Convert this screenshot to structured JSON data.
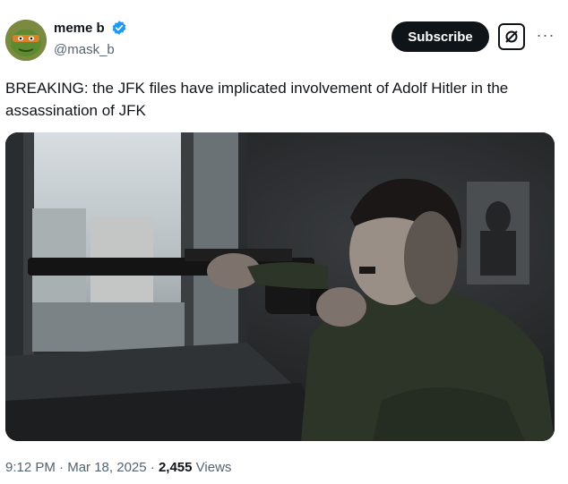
{
  "author": {
    "display_name": "meme b",
    "handle": "@mask_b",
    "avatar_icon": "cartoon-turtle-avatar",
    "verified": true,
    "verified_color": "#1d9bf0"
  },
  "actions": {
    "subscribe_label": "Subscribe",
    "grok_icon": "grok-slash-icon",
    "more_label": "···"
  },
  "tweet": {
    "text": "BREAKING: the JFK files have implicated involvement of Adolf Hitler in the assassination of JFK"
  },
  "meta": {
    "time": "9:12 PM",
    "sep1": "·",
    "date": "Mar 18, 2025",
    "sep2": "·",
    "views_count": "2,455",
    "views_label": "Views"
  }
}
